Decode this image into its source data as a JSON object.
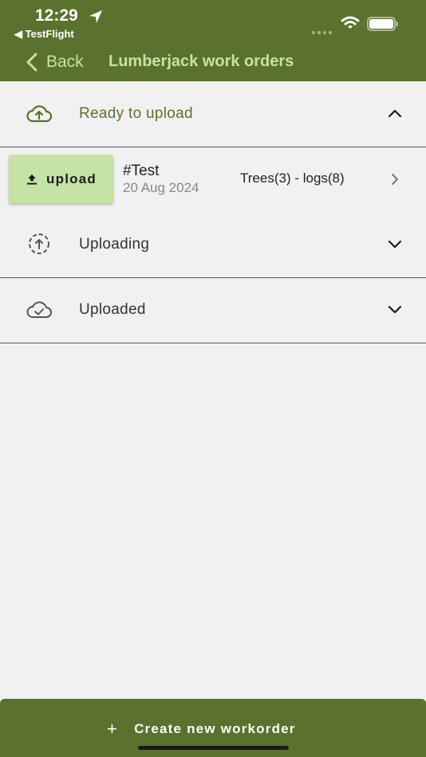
{
  "status_bar": {
    "time": "12:29",
    "back_app": "◀ TestFlight"
  },
  "nav": {
    "back_label": "Back",
    "title": "Lumberjack work orders"
  },
  "sections": [
    {
      "label": "Ready to upload",
      "icon": "cloud-upload-icon",
      "expanded": true
    },
    {
      "label": "Uploading",
      "icon": "upload-progress-icon",
      "expanded": false
    },
    {
      "label": "Uploaded",
      "icon": "cloud-check-icon",
      "expanded": false
    }
  ],
  "work_order": {
    "upload_label": "upload",
    "title": "#Test",
    "date": "20 Aug 2024",
    "counts": "Trees(3) - logs(8)"
  },
  "footer": {
    "plus": "+",
    "create_label": "Create new workorder"
  },
  "colors": {
    "header": "#5a722d",
    "accent_text": "#c7e2a5",
    "upload_button": "#c5e3a5",
    "background": "#f1f1f1"
  }
}
